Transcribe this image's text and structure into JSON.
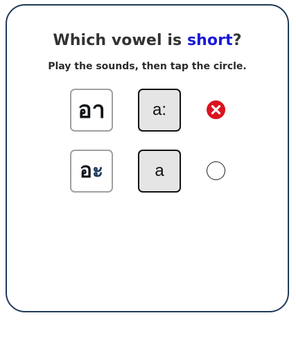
{
  "quiz": {
    "title_prefix": "Which vowel is ",
    "title_accent": "short",
    "title_suffix": "?",
    "instruction": "Play the sounds, then tap the circle.",
    "accent_color": "#1a1ad6"
  },
  "options": [
    {
      "thai_consonant": "อ",
      "thai_vowel": "า",
      "sound_label": "a:",
      "answer_state": "wrong",
      "answer_icon": "close-circle-icon"
    },
    {
      "thai_consonant": "อ",
      "thai_vowel": "ะ",
      "sound_label": "a",
      "answer_state": "unselected",
      "answer_icon": "empty-circle-icon"
    }
  ]
}
